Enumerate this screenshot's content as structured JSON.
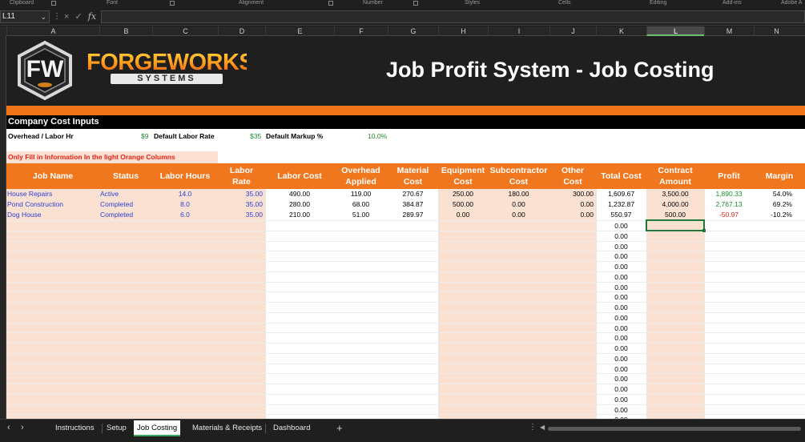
{
  "ribbon": {
    "groups": [
      "Clipboard",
      "Font",
      "Alignment",
      "Number",
      "Styles",
      "Cells",
      "Editing",
      "Add-ins",
      "Adobe A"
    ]
  },
  "formula_bar": {
    "name_box": "L11",
    "cancel_icon": "×",
    "enter_icon": "✓",
    "fx_label": "fx",
    "formula": ""
  },
  "columns": [
    "A",
    "B",
    "C",
    "D",
    "E",
    "F",
    "G",
    "H",
    "I",
    "J",
    "K",
    "L",
    "M",
    "N"
  ],
  "selected_column": "L",
  "banner": {
    "logo_letters": "FW",
    "brand_top": "FORGEWORKS",
    "brand_bottom": "SYSTEMS",
    "title": "Job Profit System - Job Costing"
  },
  "inputs": {
    "section_title": "Company Cost Inputs",
    "overhead_label": "Overhead / Labor Hr",
    "overhead_value": "$9",
    "labor_rate_label": "Default Labor Rate",
    "labor_rate_value": "$35",
    "markup_label": "Default Markup %",
    "markup_value": "10.0%"
  },
  "note": "Only Fill in Information In the light Orange Columns",
  "table": {
    "headers": {
      "job_name": "Job Name",
      "status": "Status",
      "labor_hours": "Labor Hours",
      "labor_rate": "Labor Rate",
      "labor_cost": "Labor Cost",
      "overhead_applied": "Overhead Applied",
      "material_cost": "Material Cost",
      "equipment_cost": "Equipment Cost",
      "subcontractor_cost": "Subcontractor Cost",
      "other_cost": "Other Cost",
      "total_cost": "Total Cost",
      "contract_amount": "Contract Amount",
      "profit": "Profit",
      "margin": "Margin"
    },
    "rows": [
      {
        "job_name": "House Repairs",
        "status": "Active",
        "labor_hours": "14.0",
        "labor_rate": "35.00",
        "labor_cost": "490.00",
        "overhead_applied": "119.00",
        "material_cost": "270.67",
        "equipment_cost": "250.00",
        "subcontractor_cost": "180.00",
        "other_cost": "300.00",
        "total_cost": "1,609.67",
        "contract_amount": "3,500.00",
        "profit": "1,890.33",
        "margin": "54.0%"
      },
      {
        "job_name": "Pond Construction",
        "status": "Completed",
        "labor_hours": "8.0",
        "labor_rate": "35.00",
        "labor_cost": "280.00",
        "overhead_applied": "68.00",
        "material_cost": "384.87",
        "equipment_cost": "500.00",
        "subcontractor_cost": "0.00",
        "other_cost": "0.00",
        "total_cost": "1,232.87",
        "contract_amount": "4,000.00",
        "profit": "2,767.13",
        "margin": "69.2%"
      },
      {
        "job_name": "Dog House",
        "status": "Completed",
        "labor_hours": "6.0",
        "labor_rate": "35.00",
        "labor_cost": "210.00",
        "overhead_applied": "51.00",
        "material_cost": "289.97",
        "equipment_cost": "0.00",
        "subcontractor_cost": "0.00",
        "other_cost": "0.00",
        "total_cost": "550.97",
        "contract_amount": "500.00",
        "profit": "-50.97",
        "margin": "-10.2%"
      }
    ],
    "empty_total": "0.00"
  },
  "sheet_tabs": [
    "Instructions",
    "Setup",
    "Job Costing",
    "Materials & Receipts",
    "Dashboard"
  ],
  "active_tab": "Job Costing",
  "add_sheet": "+",
  "colors": {
    "orange": "#f0771e",
    "light_orange": "#fbe1d2",
    "profit_positive": "#1e8a2e",
    "profit_negative": "#d8251b",
    "input_text": "#2b3fd6"
  }
}
